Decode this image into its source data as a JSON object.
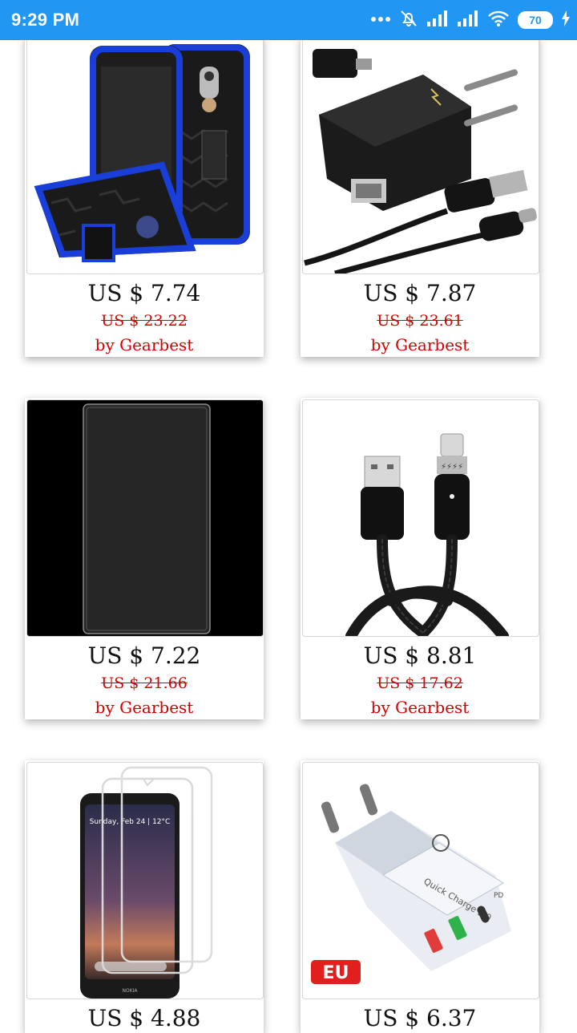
{
  "status_bar": {
    "time": "9:29 PM",
    "battery": "70",
    "icons": [
      "dots-icon",
      "mute-icon",
      "signal-icon",
      "signal-icon",
      "wifi-icon",
      "battery-icon",
      "charging-icon"
    ]
  },
  "products": [
    {
      "price": "US $ 7.74",
      "old_price": "US $ 23.22",
      "seller": "by Gearbest",
      "image": "rugged-phone-case"
    },
    {
      "price": "US $ 7.87",
      "old_price": "US $ 23.61",
      "seller": "by Gearbest",
      "image": "wall-charger-cable"
    },
    {
      "price": "US $ 7.22",
      "old_price": "US $ 21.66",
      "seller": "by Gearbest",
      "image": "glass-screen-protector"
    },
    {
      "price": "US $ 8.81",
      "old_price": "US $ 17.62",
      "seller": "by Gearbest",
      "image": "magnetic-usb-cable"
    },
    {
      "price": "US $ 4.88",
      "image": "phone-screen-protector"
    },
    {
      "price": "US $ 6.37",
      "image": "eu-quick-charger"
    }
  ],
  "images": {
    "phone_wallpaper_text": "Sunday, Feb 24 | 12°C",
    "phone_brand": "NOKIA",
    "eu_badge": "EU",
    "charger_text": "Quick Charge 3.0",
    "port_pd": "PD"
  },
  "colors": {
    "status_bar": "#2196f3",
    "sale_red": "#d40000"
  }
}
